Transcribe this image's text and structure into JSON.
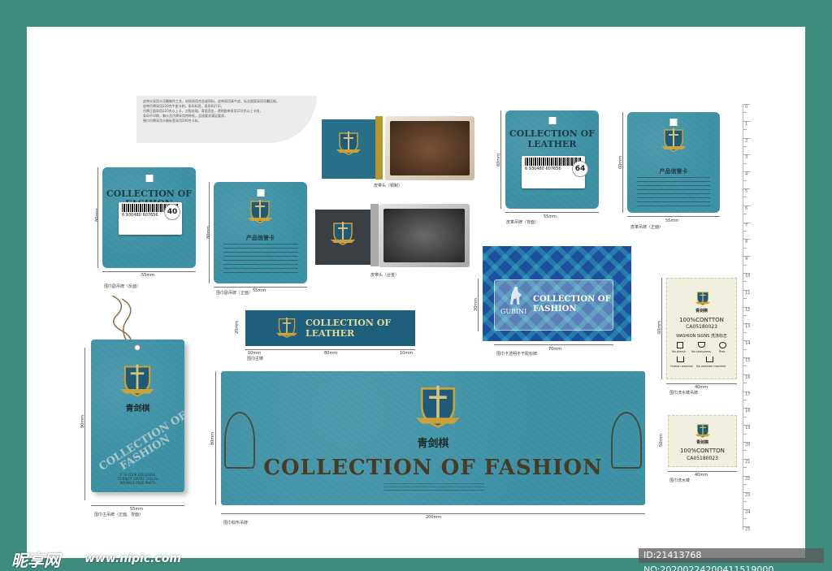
{
  "desc_text": [
    "皮带头采用卡浮雕制作工艺，材质采用合金或铜料，皮带采用真牛皮，标志图案采用浮雕压痕，",
    "皮带吊牌采用220克牛皮卡制，条码标签，条形码打印。",
    "吊牌正面采用220克以上卡，刀版处理。背面烫金，透明胶带采用220克以上卡纸，",
    "条码不印刷，胸卡及吊牌采用特种纸，品质要求满足要求。",
    "围巾吊牌采用卡制标签采用200克卡料。"
  ],
  "brand_cn": "青剑棋",
  "collection_fashion": "COLLECTION OF FASHION",
  "collection_of": "COLLECTION OF",
  "fashion": "FASHION",
  "leather": "LEATHER",
  "collection_leather": "COLLECTION OF LEATHER",
  "gubini": "GUBINI",
  "product_card": "产品信誉卡",
  "barcode_num_a": "6 930480",
  "barcode_num_b": "607656",
  "badge_40": "40",
  "badge_64": "64",
  "dims": {
    "w55": "55mm",
    "h80": "80mm",
    "h60": "60mm",
    "h20": "20mm",
    "h30": "30mm",
    "h90": "90mm",
    "w10": "10mm",
    "w80": "80mm",
    "w70": "70mm",
    "w40": "40mm",
    "w200": "200mm",
    "h50": "50mm"
  },
  "captions": {
    "tag1": "围巾副吊牌（反面）",
    "tag2": "围巾副吊牌（正面）",
    "belt_copper": "皮带头（铜制）",
    "belt_alloy": "皮带头（合金）",
    "leather_back": "皮革吊牌（背面）",
    "leather_front": "皮革吊牌（正面）",
    "main_tag": "围巾主吊牌（正面、背面）",
    "neck_label": "围巾主唛",
    "transparent": "围巾卡透明不干胶标牌",
    "wash_label": "围巾洗水唛吊牌",
    "big_label": "围巾标形吊牌",
    "wash_small": "围巾洗水唛"
  },
  "care": {
    "cotton": "100%CONTTON",
    "code": "CA05180023",
    "wash_title": "WASHION SIGNS 洗涤标志",
    "icons": [
      "No bleach",
      "No sharpness",
      "Plea",
      "Human washion",
      "No washion machine"
    ]
  },
  "hang_tag_text": [
    "IT IS YOUR EXCLUSIVE",
    "TO ENJOY SMART CASUAL",
    "WRINKLE FREE PANTS"
  ],
  "ruler_nums": [
    "0",
    "1",
    "2",
    "3",
    "4",
    "5",
    "6",
    "7",
    "8",
    "9",
    "10",
    "11",
    "12",
    "13",
    "14",
    "15",
    "16",
    "17",
    "18",
    "19",
    "20",
    "21",
    "22",
    "23",
    "24",
    "25"
  ],
  "watermark_cn": "昵享网",
  "watermark_url": "www.nipic.com",
  "image_id": "ID:21413768 NO:20200224200411519000",
  "colors": {
    "frame": "#3e8c7e",
    "teal": "#3f93a7",
    "navy": "#1f5a78",
    "gold": "#c9a23a",
    "brown": "#4a3a24"
  }
}
